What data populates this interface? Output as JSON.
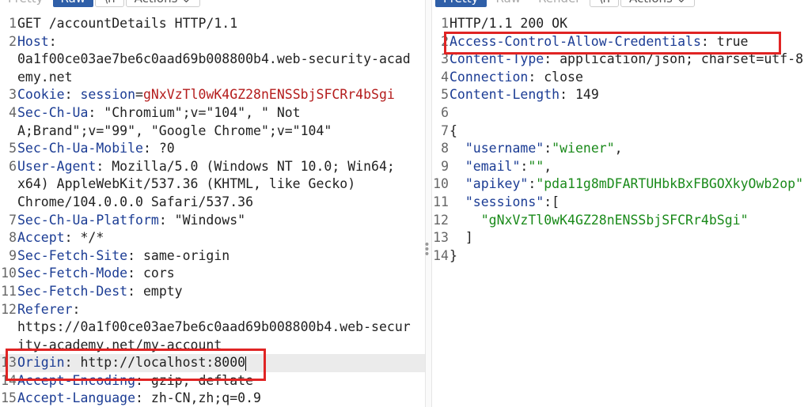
{
  "request": {
    "tabs": [
      "Pretty",
      "Raw",
      "\\n",
      "Actions ⌄"
    ],
    "active_tab": 1,
    "lines": [
      {
        "n": "1",
        "segs": [
          {
            "t": "GET /accountDetails HTTP/1.1",
            "c": ""
          }
        ]
      },
      {
        "n": "2",
        "segs": [
          {
            "t": "Host",
            "c": "k"
          },
          {
            "t": ":",
            "c": ""
          }
        ]
      },
      {
        "n": "",
        "segs": [
          {
            "t": "0a1f00ce03ae7be6c0aad69b008800b4.web-security-acad",
            "c": ""
          }
        ]
      },
      {
        "n": "",
        "segs": [
          {
            "t": "emy.net",
            "c": ""
          }
        ]
      },
      {
        "n": "3",
        "segs": [
          {
            "t": "Cookie",
            "c": "k"
          },
          {
            "t": ": ",
            "c": ""
          },
          {
            "t": "session",
            "c": "ck"
          },
          {
            "t": "=",
            "c": ""
          },
          {
            "t": "gNxVzTl0wK4GZ28nENSSbjSFCRr4bSgi",
            "c": "cv"
          }
        ]
      },
      {
        "n": "4",
        "segs": [
          {
            "t": "Sec-Ch-Ua",
            "c": "k"
          },
          {
            "t": ": \"Chromium\";v=\"104\", \" Not",
            "c": ""
          }
        ]
      },
      {
        "n": "",
        "segs": [
          {
            "t": "A;Brand\";v=\"99\", \"Google Chrome\";v=\"104\"",
            "c": ""
          }
        ]
      },
      {
        "n": "5",
        "segs": [
          {
            "t": "Sec-Ch-Ua-Mobile",
            "c": "k"
          },
          {
            "t": ": ?0",
            "c": ""
          }
        ]
      },
      {
        "n": "6",
        "segs": [
          {
            "t": "User-Agent",
            "c": "k"
          },
          {
            "t": ": Mozilla/5.0 (Windows NT 10.0; Win64;",
            "c": ""
          }
        ]
      },
      {
        "n": "",
        "segs": [
          {
            "t": "x64) AppleWebKit/537.36 (KHTML, like Gecko)",
            "c": ""
          }
        ]
      },
      {
        "n": "",
        "segs": [
          {
            "t": "Chrome/104.0.0.0 Safari/537.36",
            "c": ""
          }
        ]
      },
      {
        "n": "7",
        "segs": [
          {
            "t": "Sec-Ch-Ua-Platform",
            "c": "k"
          },
          {
            "t": ": \"Windows\"",
            "c": ""
          }
        ]
      },
      {
        "n": "8",
        "segs": [
          {
            "t": "Accept",
            "c": "k"
          },
          {
            "t": ": */*",
            "c": ""
          }
        ]
      },
      {
        "n": "9",
        "segs": [
          {
            "t": "Sec-Fetch-Site",
            "c": "k"
          },
          {
            "t": ": same-origin",
            "c": ""
          }
        ]
      },
      {
        "n": "10",
        "segs": [
          {
            "t": "Sec-Fetch-Mode",
            "c": "k"
          },
          {
            "t": ": cors",
            "c": ""
          }
        ]
      },
      {
        "n": "11",
        "segs": [
          {
            "t": "Sec-Fetch-Dest",
            "c": "k"
          },
          {
            "t": ": empty",
            "c": ""
          }
        ]
      },
      {
        "n": "12",
        "segs": [
          {
            "t": "Referer",
            "c": "k"
          },
          {
            "t": ":",
            "c": ""
          }
        ]
      },
      {
        "n": "",
        "segs": [
          {
            "t": "https://0a1f00ce03ae7be6c0aad69b008800b4.web-secur",
            "c": ""
          }
        ]
      },
      {
        "n": "",
        "segs": [
          {
            "t": "ity-academy.net/my-account",
            "c": ""
          }
        ]
      },
      {
        "n": "13",
        "segs": [
          {
            "t": "Origin",
            "c": "k"
          },
          {
            "t": ": http://localhost:8000",
            "c": ""
          }
        ],
        "highlight": true,
        "caret": true
      },
      {
        "n": "14",
        "segs": [
          {
            "t": "Accept-Encoding",
            "c": "k"
          },
          {
            "t": ": gzip, deflate",
            "c": ""
          }
        ]
      },
      {
        "n": "15",
        "segs": [
          {
            "t": "Accept-Language",
            "c": "k"
          },
          {
            "t": ": zh-CN,zh;q=0.9",
            "c": ""
          }
        ]
      }
    ]
  },
  "response": {
    "tabs": [
      "Pretty",
      "Raw",
      "Render",
      "\\n",
      "Actions ⌄"
    ],
    "active_tab": 0,
    "lines": [
      {
        "n": "1",
        "segs": [
          {
            "t": "HTTP/1.1 200 OK",
            "c": ""
          }
        ]
      },
      {
        "n": "2",
        "segs": [
          {
            "t": "Access-Control-Allow-Credentials",
            "c": "k"
          },
          {
            "t": ": true",
            "c": ""
          }
        ]
      },
      {
        "n": "3",
        "segs": [
          {
            "t": "Content-Type",
            "c": "k"
          },
          {
            "t": ": application/json; charset=utf-8",
            "c": ""
          }
        ]
      },
      {
        "n": "4",
        "segs": [
          {
            "t": "Connection",
            "c": "k"
          },
          {
            "t": ": close",
            "c": ""
          }
        ]
      },
      {
        "n": "5",
        "segs": [
          {
            "t": "Content-Length",
            "c": "k"
          },
          {
            "t": ": 149",
            "c": ""
          }
        ]
      },
      {
        "n": "6",
        "segs": []
      },
      {
        "n": "7",
        "segs": [
          {
            "t": "{",
            "c": ""
          }
        ]
      },
      {
        "n": "8",
        "segs": [
          {
            "t": "  ",
            "c": ""
          },
          {
            "t": "\"username\"",
            "c": "js-key"
          },
          {
            "t": ":",
            "c": ""
          },
          {
            "t": "\"wiener\"",
            "c": "js-str"
          },
          {
            "t": ",",
            "c": ""
          }
        ]
      },
      {
        "n": "9",
        "segs": [
          {
            "t": "  ",
            "c": ""
          },
          {
            "t": "\"email\"",
            "c": "js-key"
          },
          {
            "t": ":",
            "c": ""
          },
          {
            "t": "\"\"",
            "c": "js-str"
          },
          {
            "t": ",",
            "c": ""
          }
        ]
      },
      {
        "n": "10",
        "segs": [
          {
            "t": "  ",
            "c": ""
          },
          {
            "t": "\"apikey\"",
            "c": "js-key"
          },
          {
            "t": ":",
            "c": ""
          },
          {
            "t": "\"pda11g8mDFARTUHbkBxFBGOXkyOwb2op\"",
            "c": "js-str"
          }
        ]
      },
      {
        "n": "11",
        "segs": [
          {
            "t": "  ",
            "c": ""
          },
          {
            "t": "\"sessions\"",
            "c": "js-key"
          },
          {
            "t": ":[",
            "c": ""
          }
        ]
      },
      {
        "n": "12",
        "segs": [
          {
            "t": "    ",
            "c": ""
          },
          {
            "t": "\"gNxVzTl0wK4GZ28nENSSbjSFCRr4bSgi\"",
            "c": "js-str"
          }
        ]
      },
      {
        "n": "13",
        "segs": [
          {
            "t": "  ]",
            "c": ""
          }
        ]
      },
      {
        "n": "14",
        "segs": [
          {
            "t": "}",
            "c": ""
          }
        ]
      }
    ]
  },
  "annotation_color": "#e02424"
}
